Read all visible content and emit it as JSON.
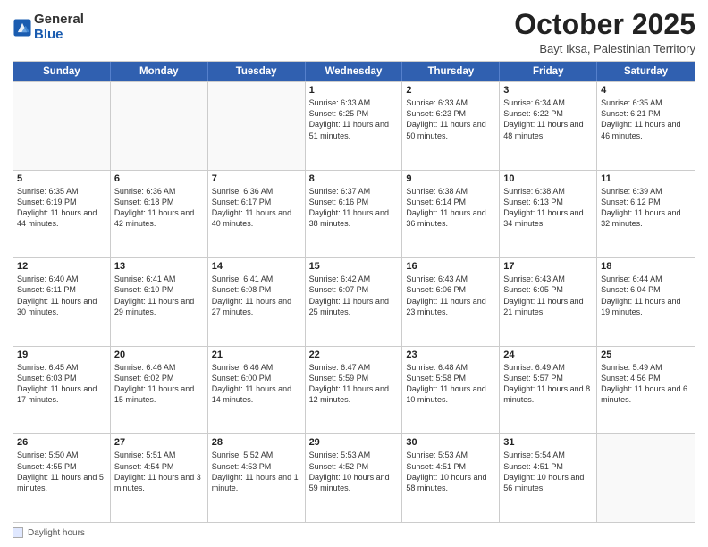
{
  "logo": {
    "general": "General",
    "blue": "Blue"
  },
  "header": {
    "month": "October 2025",
    "location": "Bayt Iksa, Palestinian Territory"
  },
  "days": [
    "Sunday",
    "Monday",
    "Tuesday",
    "Wednesday",
    "Thursday",
    "Friday",
    "Saturday"
  ],
  "footer": {
    "label": "Daylight hours"
  },
  "weeks": [
    [
      {
        "day": "",
        "sunrise": "",
        "sunset": "",
        "daylight": ""
      },
      {
        "day": "",
        "sunrise": "",
        "sunset": "",
        "daylight": ""
      },
      {
        "day": "",
        "sunrise": "",
        "sunset": "",
        "daylight": ""
      },
      {
        "day": "1",
        "sunrise": "Sunrise: 6:33 AM",
        "sunset": "Sunset: 6:25 PM",
        "daylight": "Daylight: 11 hours and 51 minutes."
      },
      {
        "day": "2",
        "sunrise": "Sunrise: 6:33 AM",
        "sunset": "Sunset: 6:23 PM",
        "daylight": "Daylight: 11 hours and 50 minutes."
      },
      {
        "day": "3",
        "sunrise": "Sunrise: 6:34 AM",
        "sunset": "Sunset: 6:22 PM",
        "daylight": "Daylight: 11 hours and 48 minutes."
      },
      {
        "day": "4",
        "sunrise": "Sunrise: 6:35 AM",
        "sunset": "Sunset: 6:21 PM",
        "daylight": "Daylight: 11 hours and 46 minutes."
      }
    ],
    [
      {
        "day": "5",
        "sunrise": "Sunrise: 6:35 AM",
        "sunset": "Sunset: 6:19 PM",
        "daylight": "Daylight: 11 hours and 44 minutes."
      },
      {
        "day": "6",
        "sunrise": "Sunrise: 6:36 AM",
        "sunset": "Sunset: 6:18 PM",
        "daylight": "Daylight: 11 hours and 42 minutes."
      },
      {
        "day": "7",
        "sunrise": "Sunrise: 6:36 AM",
        "sunset": "Sunset: 6:17 PM",
        "daylight": "Daylight: 11 hours and 40 minutes."
      },
      {
        "day": "8",
        "sunrise": "Sunrise: 6:37 AM",
        "sunset": "Sunset: 6:16 PM",
        "daylight": "Daylight: 11 hours and 38 minutes."
      },
      {
        "day": "9",
        "sunrise": "Sunrise: 6:38 AM",
        "sunset": "Sunset: 6:14 PM",
        "daylight": "Daylight: 11 hours and 36 minutes."
      },
      {
        "day": "10",
        "sunrise": "Sunrise: 6:38 AM",
        "sunset": "Sunset: 6:13 PM",
        "daylight": "Daylight: 11 hours and 34 minutes."
      },
      {
        "day": "11",
        "sunrise": "Sunrise: 6:39 AM",
        "sunset": "Sunset: 6:12 PM",
        "daylight": "Daylight: 11 hours and 32 minutes."
      }
    ],
    [
      {
        "day": "12",
        "sunrise": "Sunrise: 6:40 AM",
        "sunset": "Sunset: 6:11 PM",
        "daylight": "Daylight: 11 hours and 30 minutes."
      },
      {
        "day": "13",
        "sunrise": "Sunrise: 6:41 AM",
        "sunset": "Sunset: 6:10 PM",
        "daylight": "Daylight: 11 hours and 29 minutes."
      },
      {
        "day": "14",
        "sunrise": "Sunrise: 6:41 AM",
        "sunset": "Sunset: 6:08 PM",
        "daylight": "Daylight: 11 hours and 27 minutes."
      },
      {
        "day": "15",
        "sunrise": "Sunrise: 6:42 AM",
        "sunset": "Sunset: 6:07 PM",
        "daylight": "Daylight: 11 hours and 25 minutes."
      },
      {
        "day": "16",
        "sunrise": "Sunrise: 6:43 AM",
        "sunset": "Sunset: 6:06 PM",
        "daylight": "Daylight: 11 hours and 23 minutes."
      },
      {
        "day": "17",
        "sunrise": "Sunrise: 6:43 AM",
        "sunset": "Sunset: 6:05 PM",
        "daylight": "Daylight: 11 hours and 21 minutes."
      },
      {
        "day": "18",
        "sunrise": "Sunrise: 6:44 AM",
        "sunset": "Sunset: 6:04 PM",
        "daylight": "Daylight: 11 hours and 19 minutes."
      }
    ],
    [
      {
        "day": "19",
        "sunrise": "Sunrise: 6:45 AM",
        "sunset": "Sunset: 6:03 PM",
        "daylight": "Daylight: 11 hours and 17 minutes."
      },
      {
        "day": "20",
        "sunrise": "Sunrise: 6:46 AM",
        "sunset": "Sunset: 6:02 PM",
        "daylight": "Daylight: 11 hours and 15 minutes."
      },
      {
        "day": "21",
        "sunrise": "Sunrise: 6:46 AM",
        "sunset": "Sunset: 6:00 PM",
        "daylight": "Daylight: 11 hours and 14 minutes."
      },
      {
        "day": "22",
        "sunrise": "Sunrise: 6:47 AM",
        "sunset": "Sunset: 5:59 PM",
        "daylight": "Daylight: 11 hours and 12 minutes."
      },
      {
        "day": "23",
        "sunrise": "Sunrise: 6:48 AM",
        "sunset": "Sunset: 5:58 PM",
        "daylight": "Daylight: 11 hours and 10 minutes."
      },
      {
        "day": "24",
        "sunrise": "Sunrise: 6:49 AM",
        "sunset": "Sunset: 5:57 PM",
        "daylight": "Daylight: 11 hours and 8 minutes."
      },
      {
        "day": "25",
        "sunrise": "Sunrise: 5:49 AM",
        "sunset": "Sunset: 4:56 PM",
        "daylight": "Daylight: 11 hours and 6 minutes."
      }
    ],
    [
      {
        "day": "26",
        "sunrise": "Sunrise: 5:50 AM",
        "sunset": "Sunset: 4:55 PM",
        "daylight": "Daylight: 11 hours and 5 minutes."
      },
      {
        "day": "27",
        "sunrise": "Sunrise: 5:51 AM",
        "sunset": "Sunset: 4:54 PM",
        "daylight": "Daylight: 11 hours and 3 minutes."
      },
      {
        "day": "28",
        "sunrise": "Sunrise: 5:52 AM",
        "sunset": "Sunset: 4:53 PM",
        "daylight": "Daylight: 11 hours and 1 minute."
      },
      {
        "day": "29",
        "sunrise": "Sunrise: 5:53 AM",
        "sunset": "Sunset: 4:52 PM",
        "daylight": "Daylight: 10 hours and 59 minutes."
      },
      {
        "day": "30",
        "sunrise": "Sunrise: 5:53 AM",
        "sunset": "Sunset: 4:51 PM",
        "daylight": "Daylight: 10 hours and 58 minutes."
      },
      {
        "day": "31",
        "sunrise": "Sunrise: 5:54 AM",
        "sunset": "Sunset: 4:51 PM",
        "daylight": "Daylight: 10 hours and 56 minutes."
      },
      {
        "day": "",
        "sunrise": "",
        "sunset": "",
        "daylight": ""
      }
    ]
  ]
}
